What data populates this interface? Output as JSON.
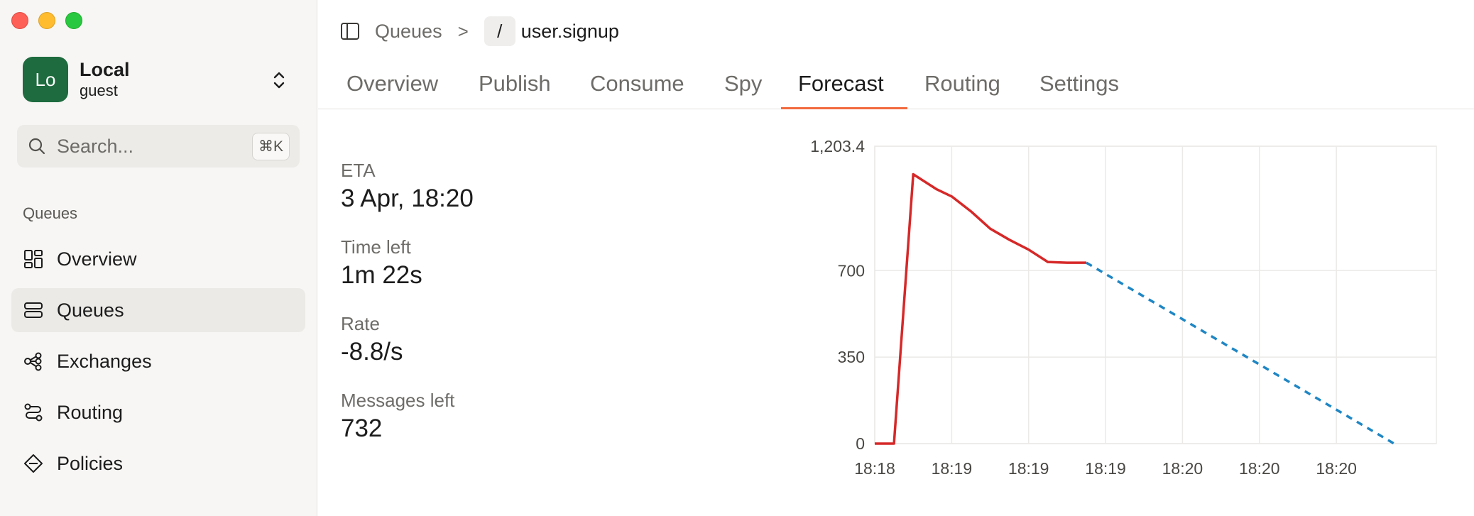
{
  "account": {
    "initials": "Lo",
    "name": "Local",
    "user": "guest"
  },
  "search": {
    "placeholder": "Search...",
    "shortcut": "⌘K"
  },
  "sidebar": {
    "section": "Queues",
    "items": [
      {
        "label": "Overview",
        "icon": "layout-dashboard-icon"
      },
      {
        "label": "Queues",
        "icon": "queues-icon",
        "active": true
      },
      {
        "label": "Exchanges",
        "icon": "exchanges-icon"
      },
      {
        "label": "Routing",
        "icon": "routing-icon"
      },
      {
        "label": "Policies",
        "icon": "policies-icon"
      }
    ]
  },
  "breadcrumb": {
    "parent": "Queues",
    "separator": ">",
    "vhost": "/",
    "queue": "user.signup"
  },
  "tabs": [
    "Overview",
    "Publish",
    "Consume",
    "Spy",
    "Forecast",
    "Routing",
    "Settings"
  ],
  "active_tab": "Forecast",
  "stats": [
    {
      "label": "ETA",
      "value": "3 Apr, 18:20"
    },
    {
      "label": "Time left",
      "value": "1m 22s"
    },
    {
      "label": "Rate",
      "value": "-8.8/s"
    },
    {
      "label": "Messages left",
      "value": "732"
    }
  ],
  "colors": {
    "accent": "#f26a3d",
    "actual_line": "#d62828",
    "forecast_line": "#1f86c4",
    "avatar": "#1d6b3e"
  },
  "chart_data": {
    "type": "line",
    "yticks": [
      "1,203.4",
      "700",
      "350",
      "0"
    ],
    "ytick_values": [
      1203.4,
      700,
      350,
      0
    ],
    "xticks": [
      "18:18",
      "18:19",
      "18:19",
      "18:19",
      "18:20",
      "18:20",
      "18:20"
    ],
    "ylim": [
      0,
      1203.4
    ],
    "xlim": [
      0,
      7.3
    ],
    "grid": true,
    "series": [
      {
        "style": "solid",
        "color": "#d62828",
        "x": [
          0,
          0.25,
          0.5,
          0.8,
          1.0,
          1.25,
          1.5,
          1.75,
          2.0,
          2.25,
          2.5,
          2.75
        ],
        "y": [
          0,
          0,
          1090,
          1030,
          1000,
          940,
          870,
          825,
          785,
          735,
          732,
          732
        ]
      },
      {
        "style": "dashed",
        "color": "#1f86c4",
        "x": [
          2.75,
          6.75
        ],
        "y": [
          732,
          0
        ]
      }
    ]
  }
}
